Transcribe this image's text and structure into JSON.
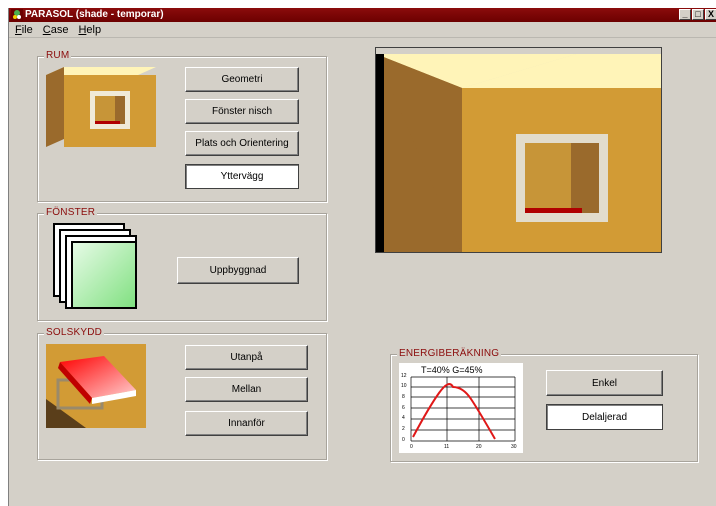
{
  "window": {
    "title": "PARASOL (shade - temporar)",
    "controls": [
      "_",
      "□",
      "X"
    ]
  },
  "menu": {
    "items": [
      {
        "label": "File",
        "accel": "F",
        "rest": "ile"
      },
      {
        "label": "Case",
        "accel": "C",
        "rest": "ase"
      },
      {
        "label": "Help",
        "accel": "H",
        "rest": "elp"
      }
    ]
  },
  "rum": {
    "label": "RUM",
    "buttons": {
      "geometri": "Geometri",
      "fonster_nisch": "Fönster nisch",
      "plats": "Plats och Orientering",
      "yttervagg": "Yttervägg"
    }
  },
  "fonster": {
    "label": "FÖNSTER",
    "buttons": {
      "uppbyggnad": "Uppbyggnad"
    }
  },
  "solskydd": {
    "label": "SOLSKYDD",
    "buttons": {
      "utanpa": "Utanpå",
      "mellan": "Mellan",
      "innanfor": "Innanför"
    }
  },
  "energi": {
    "label": "ENERGIBERÄKNING",
    "chart_title": "T=40%  G=45%",
    "buttons": {
      "enkel": "Enkel",
      "detaljerad": "Delaljerad"
    },
    "y_ticks": [
      "12",
      "10",
      "8",
      "6",
      "4",
      "2",
      "0"
    ],
    "x_ticks": [
      "0",
      "11",
      "20",
      "30"
    ]
  },
  "colors": {
    "title_bar": "#8b0c0c",
    "wall_front": "#d29b35",
    "wall_side": "#9a6a2c",
    "wall_top": "#fff4b8",
    "curve": "#e01818",
    "group_label": "#8b0c0c"
  }
}
